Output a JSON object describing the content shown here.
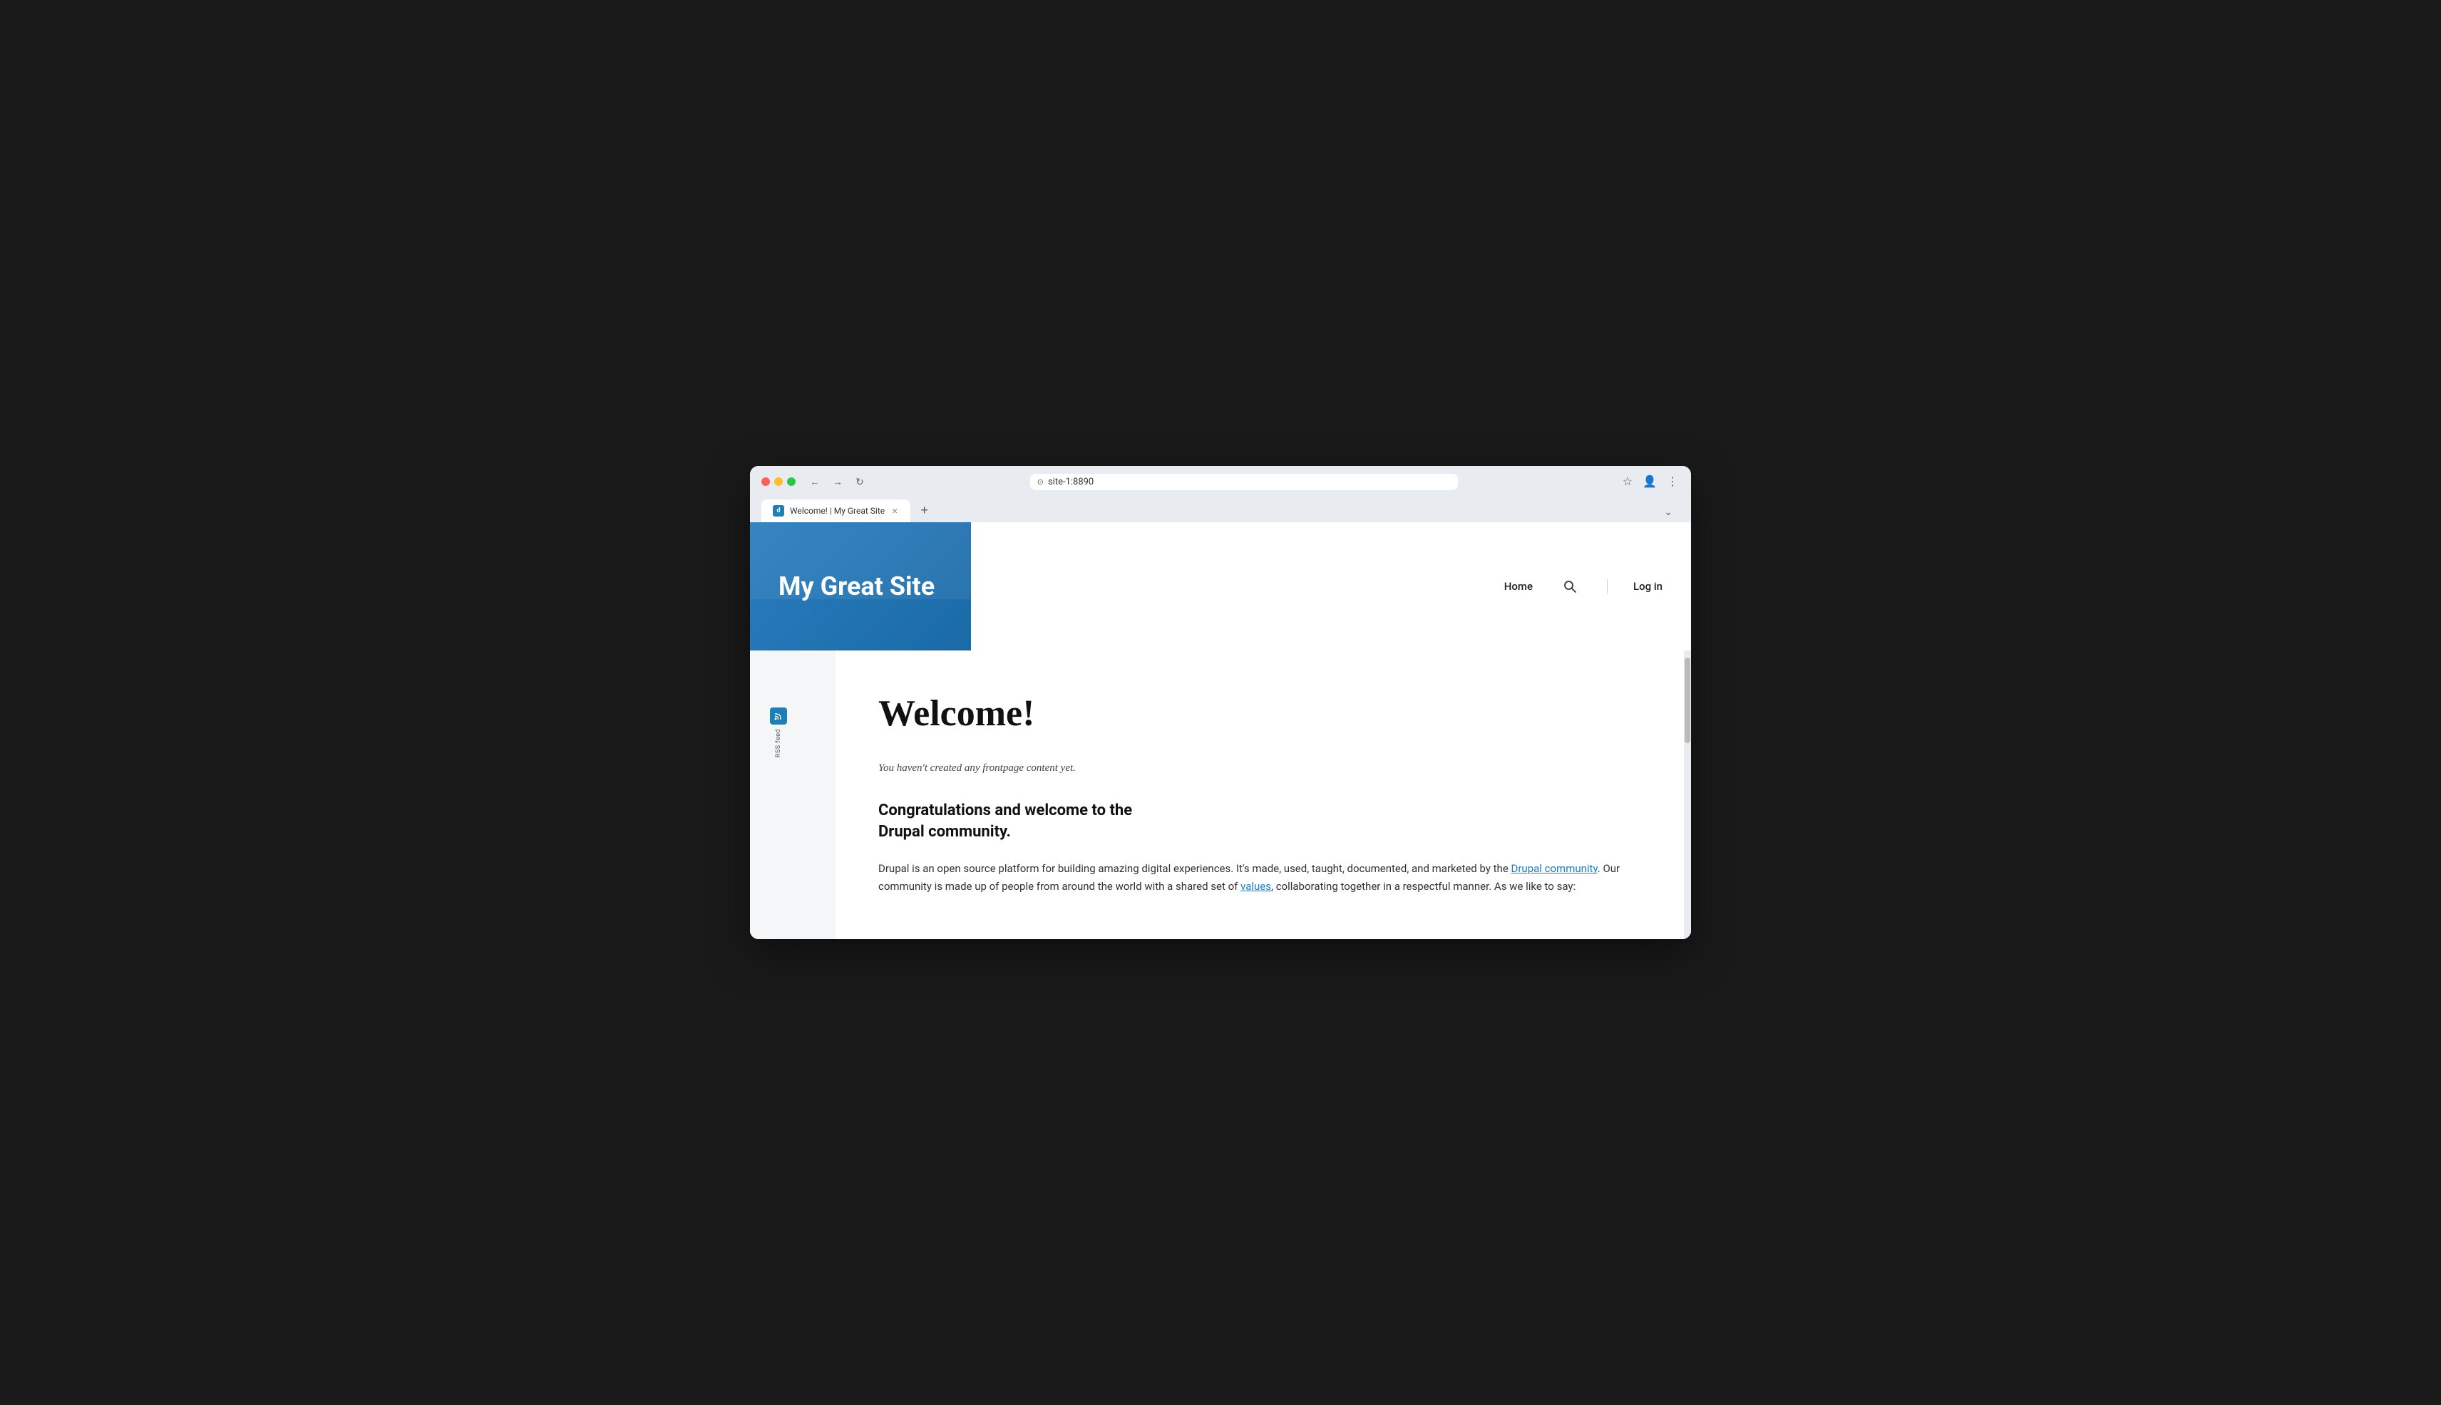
{
  "browser": {
    "tab_title": "Welcome! | My Great Site",
    "tab_favicon_text": "d",
    "url": "site-1:8890",
    "new_tab_label": "+",
    "close_tab_label": "×"
  },
  "nav_buttons": {
    "back": "←",
    "forward": "→",
    "reload": "↻"
  },
  "browser_actions": {
    "bookmark": "☆",
    "profile": "👤",
    "menu": "⋮",
    "expand": "⌄"
  },
  "site": {
    "logo": "My Great Site",
    "nav": {
      "home": "Home",
      "login": "Log in"
    },
    "rss": {
      "label": "RSS feed"
    },
    "page": {
      "title": "Welcome!",
      "notice": "You haven't created any frontpage content yet.",
      "congrats_heading": "Congratulations and welcome to the\nDrupal community.",
      "body_text": "Drupal is an open source platform for building amazing digital experiences. It's made, used, taught, documented, and marketed by the ",
      "drupal_community_link": "Drupal community",
      "body_text_2": ". Our community is made up of people from around the world with a shared set of ",
      "values_link": "values",
      "body_text_3": ", collaborating together in a respectful manner. As we like to say:"
    }
  }
}
